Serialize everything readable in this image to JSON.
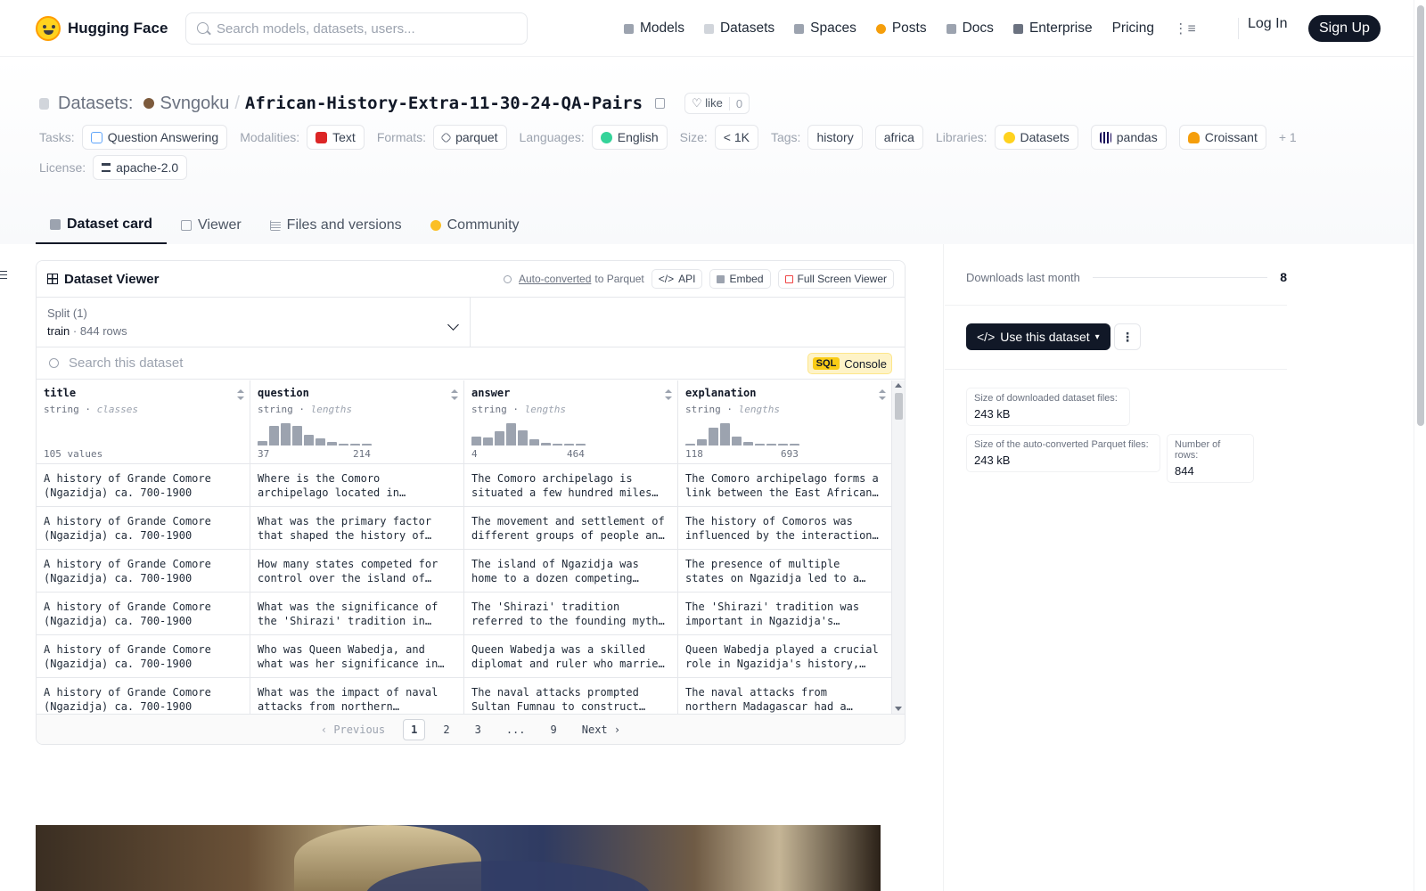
{
  "nav": {
    "brand": "Hugging Face",
    "search_placeholder": "Search models, datasets, users...",
    "links": [
      {
        "label": "Models",
        "icon": "models-icon",
        "color": "#9ca3af"
      },
      {
        "label": "Datasets",
        "icon": "datasets-icon",
        "color": "#d1d5db"
      },
      {
        "label": "Spaces",
        "icon": "spaces-icon",
        "color": "#9ca3af"
      },
      {
        "label": "Posts",
        "icon": "posts-icon",
        "color": "#f59e0b"
      },
      {
        "label": "Docs",
        "icon": "docs-icon",
        "color": "#9ca3af"
      },
      {
        "label": "Enterprise",
        "icon": "enterprise-icon",
        "color": "#6b7280"
      },
      {
        "label": "Pricing",
        "icon": "",
        "color": ""
      }
    ],
    "login": "Log In",
    "signup": "Sign Up"
  },
  "header": {
    "section": "Datasets:",
    "owner": "Svngoku",
    "separator": "/",
    "name": "African-History-Extra-11-30-24-QA-Pairs",
    "like_label": "like",
    "like_count": "0",
    "tasks_label": "Tasks:",
    "task": "Question Answering",
    "modalities_label": "Modalities:",
    "modality": "Text",
    "formats_label": "Formats:",
    "format": "parquet",
    "languages_label": "Languages:",
    "language": "English",
    "size_label": "Size:",
    "size": "< 1K",
    "tags_label": "Tags:",
    "tag1": "history",
    "tag2": "africa",
    "libraries_label": "Libraries:",
    "lib1": "Datasets",
    "lib2": "pandas",
    "lib3": "Croissant",
    "more_libs": "+ 1",
    "license_label": "License:",
    "license": "apache-2.0"
  },
  "tabs": {
    "card": "Dataset card",
    "viewer": "Viewer",
    "files": "Files and versions",
    "community": "Community"
  },
  "viewer": {
    "title": "Dataset Viewer",
    "auto_converted": "Auto-converted",
    "to_parquet": "to Parquet",
    "api": "API",
    "embed": "Embed",
    "fullscreen": "Full Screen Viewer",
    "split_label": "Split (1)",
    "split_name": "train",
    "split_rows": "844 rows",
    "search_placeholder": "Search this dataset",
    "sql": "SQL",
    "console": "Console",
    "columns": [
      {
        "name": "title",
        "type": "string",
        "kind": "classes",
        "summary": "105 values",
        "min": "",
        "max": "",
        "hist": []
      },
      {
        "name": "question",
        "type": "string",
        "kind": "lengths",
        "summary": "",
        "min": "37",
        "max": "214",
        "hist": [
          0.2,
          0.85,
          0.95,
          0.85,
          0.45,
          0.3,
          0.15,
          0.06,
          0.04,
          0.04
        ]
      },
      {
        "name": "answer",
        "type": "string",
        "kind": "lengths",
        "summary": "",
        "min": "4",
        "max": "464",
        "hist": [
          0.4,
          0.35,
          0.6,
          0.95,
          0.65,
          0.25,
          0.1,
          0.05,
          0.04,
          0.04
        ]
      },
      {
        "name": "explanation",
        "type": "string",
        "kind": "lengths",
        "summary": "",
        "min": "118",
        "max": "693",
        "hist": [
          0.06,
          0.25,
          0.75,
          0.95,
          0.4,
          0.15,
          0.08,
          0.05,
          0.04,
          0.04
        ]
      }
    ],
    "rows": [
      [
        "A history of Grande Comore (Ngazidja) ca. 700-1900",
        "Where is the Comoro archipelago located in relation to the East African coast?",
        "The Comoro archipelago is situated a few hundred miles off the East African coast.",
        "The Comoro archipelago forms a link between the East African coast and Madagascar."
      ],
      [
        "A history of Grande Comore (Ngazidja) ca. 700-1900",
        "What was the primary factor that shaped the history of Comoros?",
        "The movement and settlement of different groups of people and cultures.",
        "The history of Comoros was influenced by the interaction of many groups."
      ],
      [
        "A history of Grande Comore (Ngazidja) ca. 700-1900",
        "How many states competed for control over the island of Ngazidja?",
        "The island of Ngazidja was home to a dozen competing states, each ruled by a sultan.",
        "The presence of multiple states on Ngazidja led to a complex political landscape."
      ],
      [
        "A history of Grande Comore (Ngazidja) ca. 700-1900",
        "What was the significance of the 'Shirazi' tradition in Ngazidja?",
        "The 'Shirazi' tradition referred to the founding myth of the ruling lineages.",
        "The 'Shirazi' tradition was important in Ngazidja's history and identity."
      ],
      [
        "A history of Grande Comore (Ngazidja) ca. 700-1900",
        "Who was Queen Wabedja, and what was her significance in Ngazidja?",
        "Queen Wabedja was a skilled diplomat and ruler who married into a rival house.",
        "Queen Wabedja played a crucial role in Ngazidja's history, uniting factions."
      ],
      [
        "A history of Grande Comore (Ngazidja) ca. 700-1900",
        "What was the impact of naval attacks from northern Madagascar on Ngazidja?",
        "The naval attacks prompted Sultan Fumnau to construct defensive walls.",
        "The naval attacks from northern Madagascar had a significant effect on the island."
      ]
    ],
    "pager": {
      "prev": "Previous",
      "pages": [
        "1",
        "2",
        "3",
        "...",
        "9"
      ],
      "current": "1",
      "next": "Next"
    }
  },
  "side": {
    "downloads_label": "Downloads last month",
    "downloads": "8",
    "use_button": "Use this dataset",
    "size_downloaded_label": "Size of downloaded dataset files:",
    "size_downloaded": "243 kB",
    "size_parquet_label": "Size of the auto-converted Parquet files:",
    "size_parquet": "243 kB",
    "num_rows_label": "Number of rows:",
    "num_rows": "844"
  }
}
